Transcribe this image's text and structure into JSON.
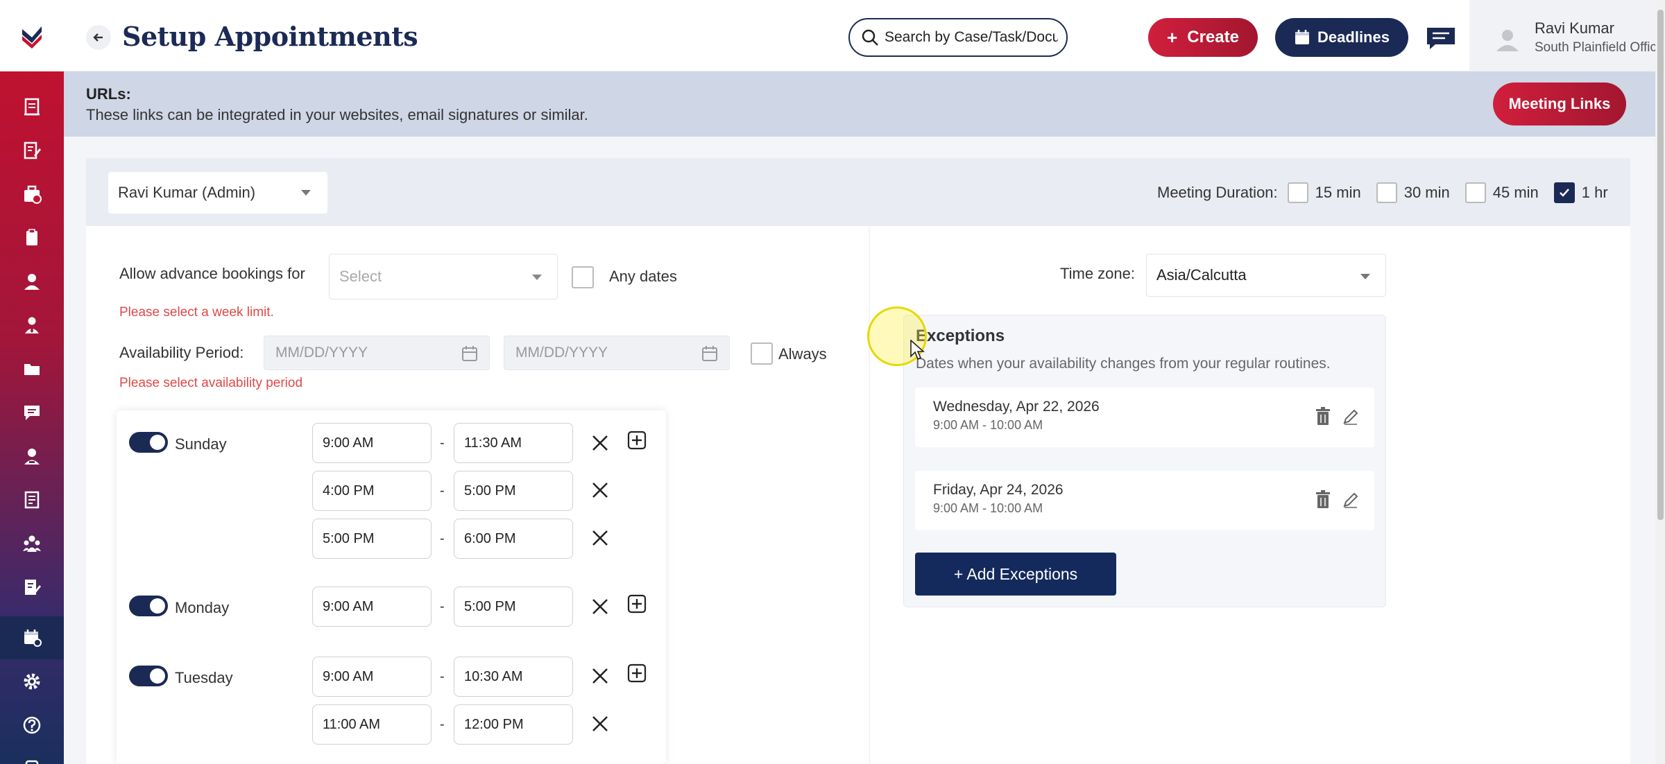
{
  "header": {
    "title": "Setup Appointments",
    "search_placeholder": "Search by Case/Task/Document",
    "create_label": "Create",
    "deadlines_label": "Deadlines",
    "user_name": "Ravi Kumar",
    "user_office": "South Plainfield Office"
  },
  "urls": {
    "title": "URLs:",
    "description": "These links can be integrated in your websites, email signatures or similar.",
    "meeting_links_label": "Meeting Links"
  },
  "settings": {
    "selected_user": "Ravi Kumar (Admin)",
    "duration_label": "Meeting Duration:",
    "durations": [
      {
        "label": "15 min",
        "checked": false
      },
      {
        "label": "30 min",
        "checked": false
      },
      {
        "label": "45 min",
        "checked": false
      },
      {
        "label": "1 hr",
        "checked": true
      }
    ],
    "advance_label": "Allow advance bookings for",
    "advance_placeholder": "Select",
    "any_dates_label": "Any dates",
    "advance_error": "Please select a week limit.",
    "availability_label": "Availability Period:",
    "date_placeholder": "MM/DD/YYYY",
    "always_label": "Always",
    "availability_error": "Please select availability period",
    "timezone_label": "Time zone:",
    "timezone_value": "Asia/Calcutta"
  },
  "schedule": [
    {
      "day": "Sunday",
      "enabled": true,
      "slots": [
        {
          "start": "9:00 AM",
          "end": "11:30 AM"
        },
        {
          "start": "4:00 PM",
          "end": "5:00 PM"
        },
        {
          "start": "5:00 PM",
          "end": "6:00 PM"
        }
      ]
    },
    {
      "day": "Monday",
      "enabled": true,
      "slots": [
        {
          "start": "9:00 AM",
          "end": "5:00 PM"
        }
      ]
    },
    {
      "day": "Tuesday",
      "enabled": true,
      "slots": [
        {
          "start": "9:00 AM",
          "end": "10:30 AM"
        },
        {
          "start": "11:00 AM",
          "end": "12:00 PM"
        }
      ]
    }
  ],
  "exceptions": {
    "title": "Exceptions",
    "description": "Dates when your availability changes from your regular routines.",
    "items": [
      {
        "date": "Wednesday, Apr 22, 2026",
        "time": "9:00 AM - 10:00 AM"
      },
      {
        "date": "Friday, Apr 24, 2026",
        "time": "9:00 AM - 10:00 AM"
      }
    ],
    "add_label": "+ Add Exceptions"
  },
  "colors": {
    "brand_red": "#c8102e",
    "brand_navy": "#1b2a55",
    "error": "#e04848"
  }
}
